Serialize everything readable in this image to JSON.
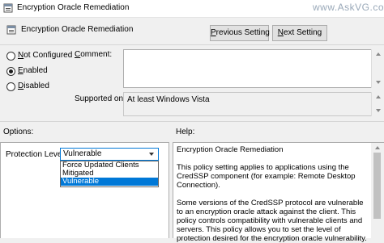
{
  "window": {
    "title": "Encryption Oracle Remediation",
    "watermark": "www.AskVG.com"
  },
  "header": {
    "title": "Encryption Oracle Remediation",
    "prev_button_pre": "",
    "prev_button_key": "P",
    "prev_button_post": "revious Setting",
    "next_button_pre": "",
    "next_button_key": "N",
    "next_button_post": "ext Setting"
  },
  "state": {
    "options": [
      {
        "pre": "",
        "key": "N",
        "post": "ot Configured",
        "selected": false
      },
      {
        "pre": "",
        "key": "E",
        "post": "nabled",
        "selected": true
      },
      {
        "pre": "",
        "key": "D",
        "post": "isabled",
        "selected": false
      }
    ]
  },
  "comment": {
    "label_pre": "",
    "label_key": "C",
    "label_post": "omment:",
    "value": ""
  },
  "supported": {
    "label": "Supported on:",
    "value": "At least Windows Vista"
  },
  "options_panel": {
    "label": "Options:",
    "protection_label": "Protection Level:",
    "selected_value": "Vulnerable",
    "dropdown_items": [
      "Force Updated Clients",
      "Mitigated",
      "Vulnerable"
    ],
    "highlighted_index": 2
  },
  "help_panel": {
    "label": "Help:",
    "paragraphs": [
      "Encryption Oracle Remediation",
      "This policy setting applies to applications using the CredSSP component (for example: Remote Desktop Connection).",
      "Some versions of the CredSSP protocol are vulnerable to an encryption oracle attack against the client.  This policy controls compatibility with vulnerable clients and servers.  This policy allows you to set the level of protection desired for the encryption oracle vulnerability."
    ]
  }
}
